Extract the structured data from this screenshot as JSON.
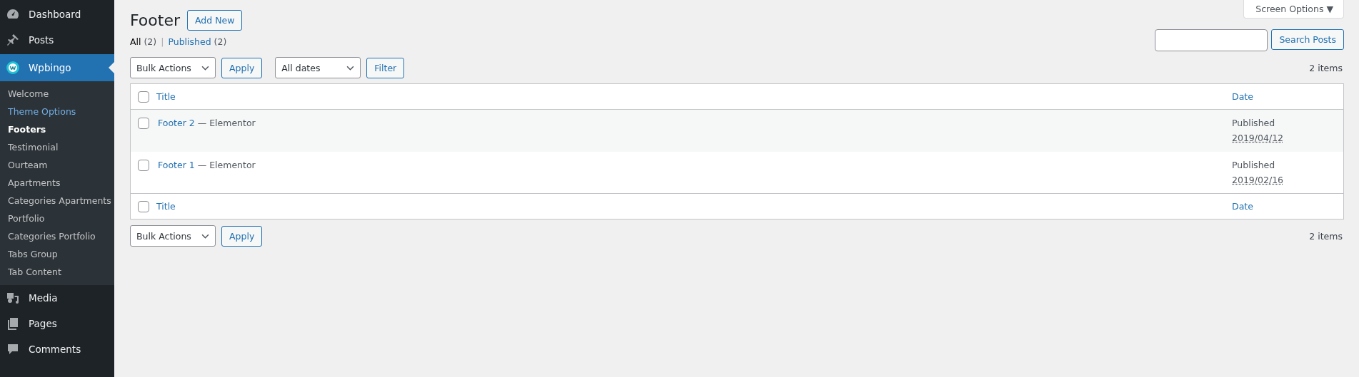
{
  "sidebar": {
    "items": [
      {
        "label": "Dashboard",
        "selected": false
      },
      {
        "label": "Posts",
        "selected": false
      },
      {
        "label": "Wpbingo",
        "selected": true,
        "children": [
          {
            "label": "Welcome",
            "selected": false,
            "hover": false
          },
          {
            "label": "Theme Options",
            "selected": false,
            "hover": true
          },
          {
            "label": "Footers",
            "selected": true,
            "hover": false
          },
          {
            "label": "Testimonial",
            "selected": false,
            "hover": false
          },
          {
            "label": "Ourteam",
            "selected": false,
            "hover": false
          },
          {
            "label": "Apartments",
            "selected": false,
            "hover": false
          },
          {
            "label": "Categories Apartments",
            "selected": false,
            "hover": false
          },
          {
            "label": "Portfolio",
            "selected": false,
            "hover": false
          },
          {
            "label": "Categories Portfolio",
            "selected": false,
            "hover": false
          },
          {
            "label": "Tabs Group",
            "selected": false,
            "hover": false
          },
          {
            "label": "Tab Content",
            "selected": false,
            "hover": false
          }
        ]
      },
      {
        "label": "Media",
        "selected": false
      },
      {
        "label": "Pages",
        "selected": false
      },
      {
        "label": "Comments",
        "selected": false
      }
    ]
  },
  "screen_options": "Screen Options ▼",
  "page_title": "Footer",
  "add_new": "Add New",
  "views_separator": "|",
  "views": [
    {
      "label": "All",
      "count": "(2)",
      "selected": true
    },
    {
      "label": "Published",
      "count": "(2)",
      "selected": false
    }
  ],
  "search": {
    "button": "Search Posts"
  },
  "top_nav": {
    "bulk_action": "Bulk Actions",
    "apply": "Apply",
    "date_filter": "All dates",
    "filter": "Filter",
    "count": "2 items"
  },
  "table": {
    "columns": [
      "Title",
      "Date"
    ],
    "select_all_checked": false,
    "footer_select_all_checked": false,
    "rows": [
      {
        "title": "Footer 2",
        "suffix": "— Elementor",
        "status": "Published",
        "date": "2019/04/12",
        "checked": false
      },
      {
        "title": "Footer 1",
        "suffix": "— Elementor",
        "status": "Published",
        "date": "2019/02/16",
        "checked": false
      }
    ],
    "footer_columns": [
      "Title",
      "Date"
    ]
  },
  "bottom_nav": {
    "bulk_action": "Bulk Actions",
    "apply": "Apply",
    "count": "2 items"
  }
}
